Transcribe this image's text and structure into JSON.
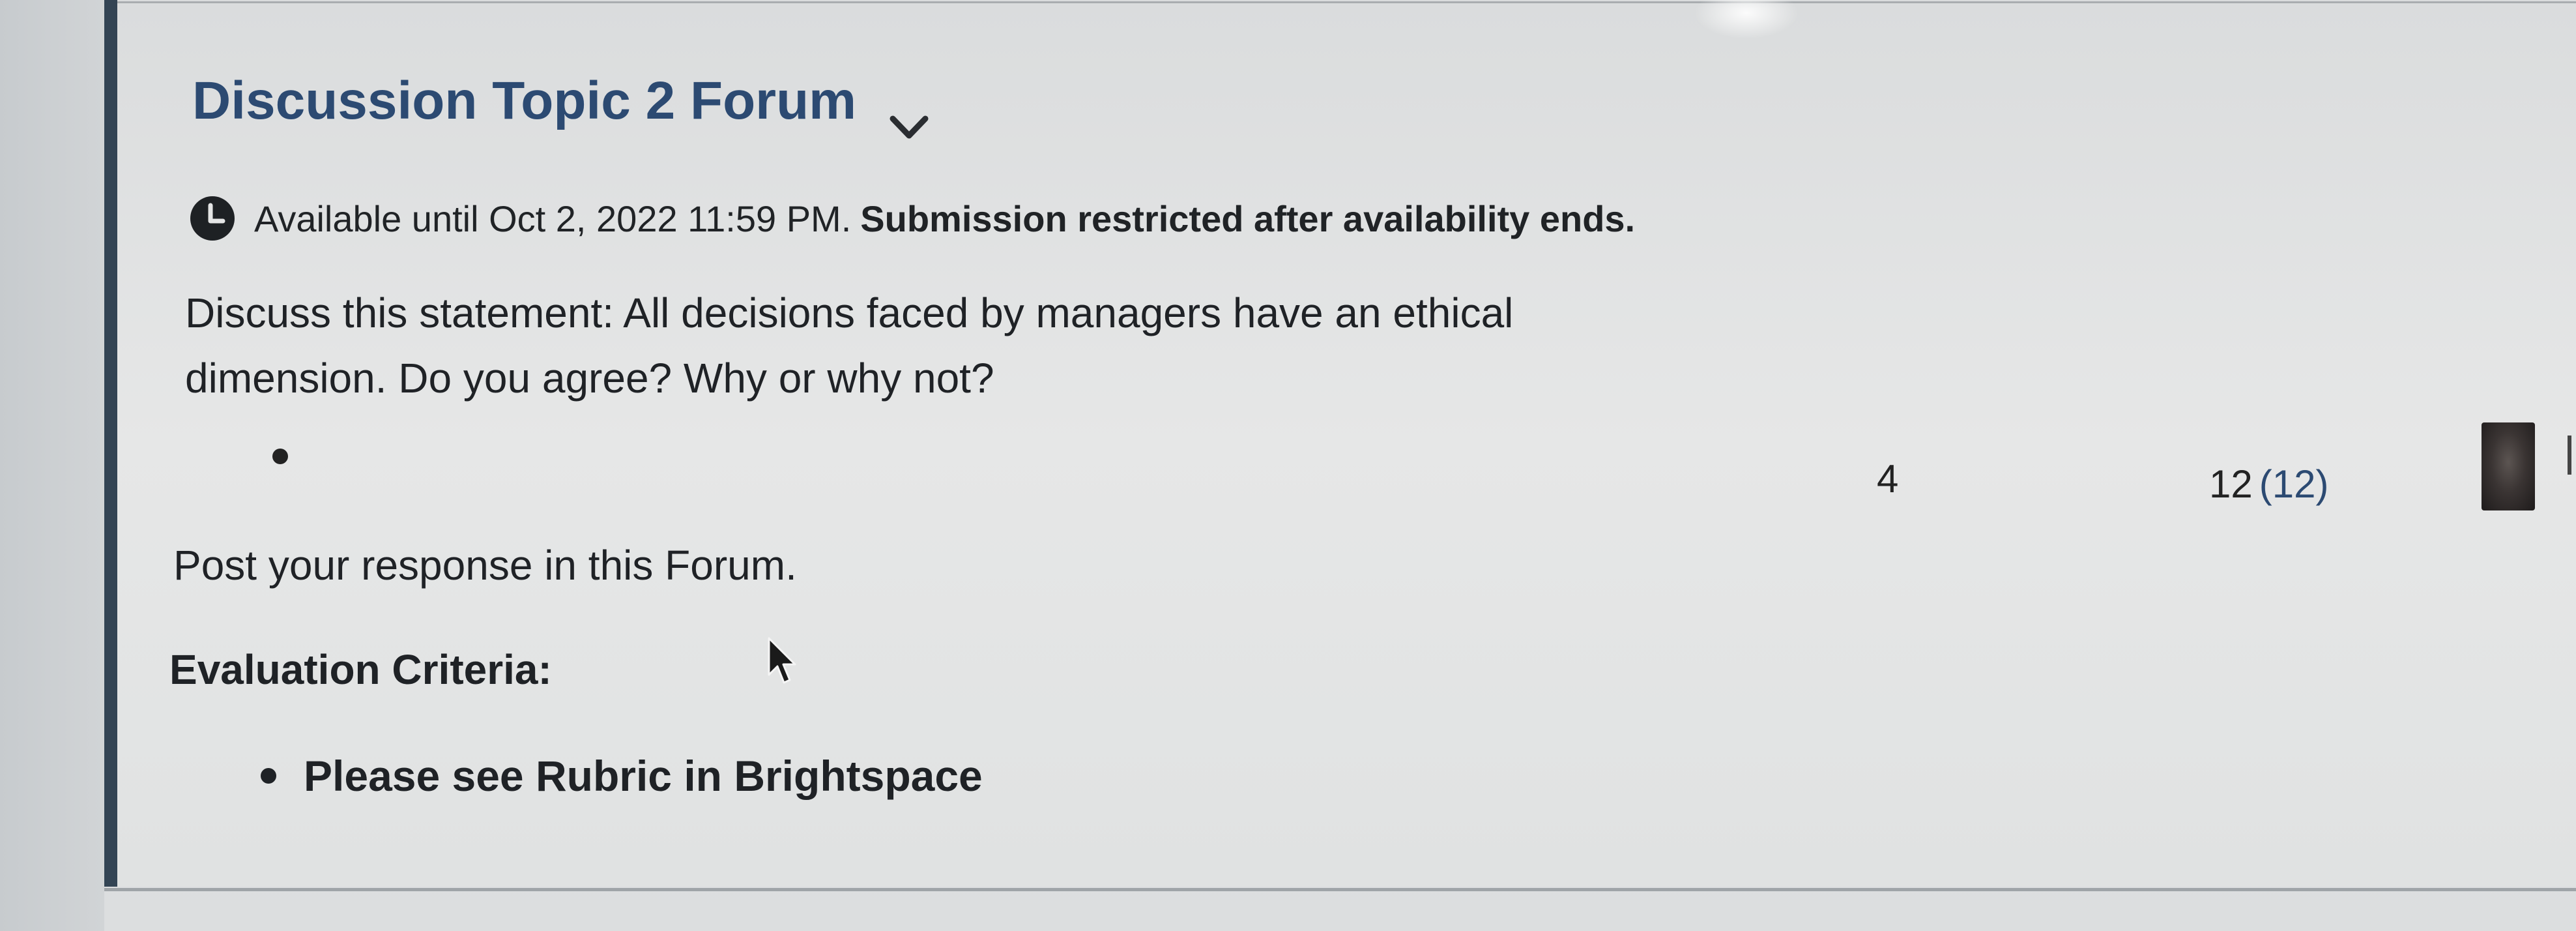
{
  "forum": {
    "title": "Discussion Topic 2 Forum",
    "availability": {
      "text": "Available until Oct 2, 2022 11:59 PM.",
      "restriction": "Submission restricted after availability ends."
    },
    "prompt": "Discuss this statement: All decisions faced by managers have an ethical dimension. Do you agree? Why or why not?",
    "threads_count": "4",
    "posts_count": "12",
    "posts_unread": "(12)",
    "instruction": "Post your response in this Forum.",
    "evaluation_heading": "Evaluation Criteria:",
    "criteria": [
      "Please see Rubric in Brightspace"
    ]
  },
  "icons": {
    "clock": "clock-icon",
    "expand": "chevron-down-icon",
    "pointer": "cursor-icon"
  },
  "colors": {
    "accent_bar": "#334454",
    "title": "#2c4a72"
  }
}
